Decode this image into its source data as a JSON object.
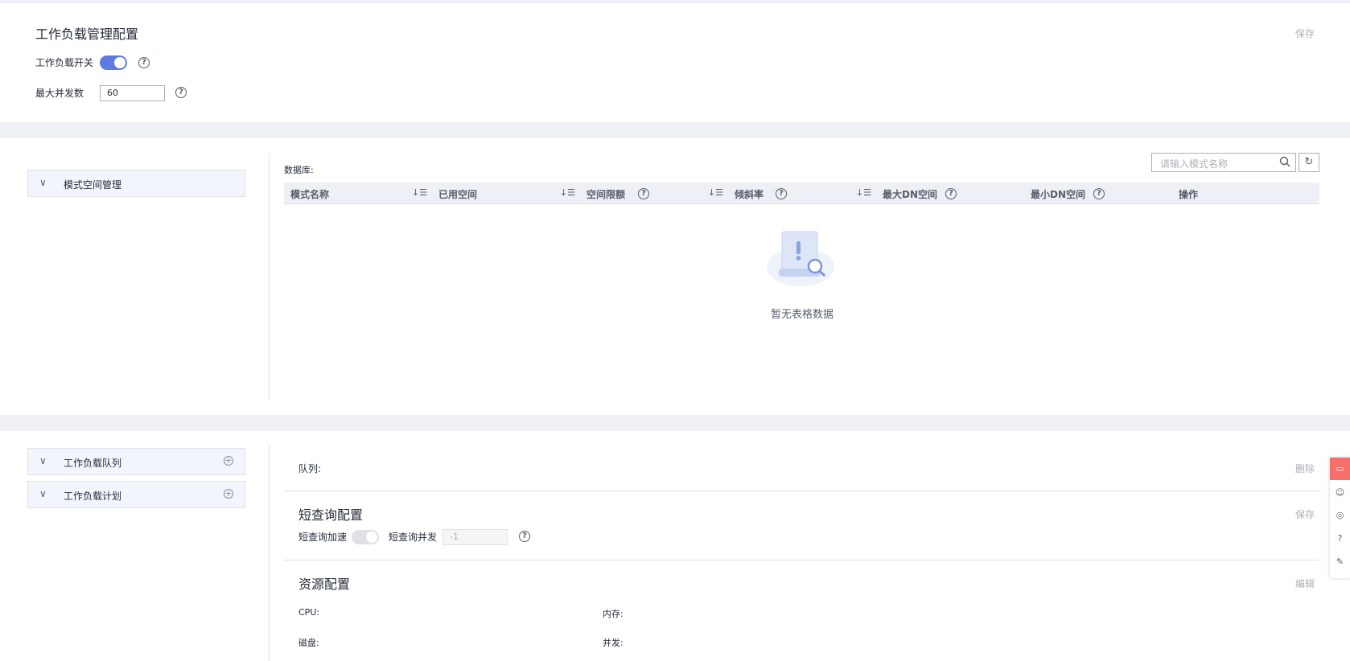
{
  "workload": {
    "title": "工作负载管理配置",
    "save": "保存",
    "switch_label": "工作负载开关",
    "switch_on": true,
    "max_concurrency_label": "最大并发数",
    "max_concurrency_value": "60"
  },
  "schema": {
    "tree_item": "模式空间管理",
    "db_label": "数据库:",
    "search_placeholder": "请输入模式名称",
    "columns": [
      "模式名称",
      "已用空间",
      "空间限额",
      "倾斜率",
      "最大DN空间",
      "最小DN空间",
      "操作"
    ],
    "empty_text": "暂无表格数据"
  },
  "queue": {
    "tree_items": [
      "工作负载队列",
      "工作负载计划"
    ],
    "queue_label": "队列:",
    "delete": "删除",
    "short_query_title": "短查询配置",
    "short_query_save": "保存",
    "short_query_accel_label": "短查询加速",
    "short_query_concurrency_label": "短查询并发",
    "short_query_concurrency_value": "-1",
    "resource_title": "资源配置",
    "resource_edit": "编辑",
    "cpu_label": "CPU:",
    "memory_label": "内存:",
    "disk_label": "磁盘:",
    "concurrency_label": "并发:"
  },
  "colors": {
    "accent": "#5e7ce0",
    "float_active": "#f66f6a"
  }
}
